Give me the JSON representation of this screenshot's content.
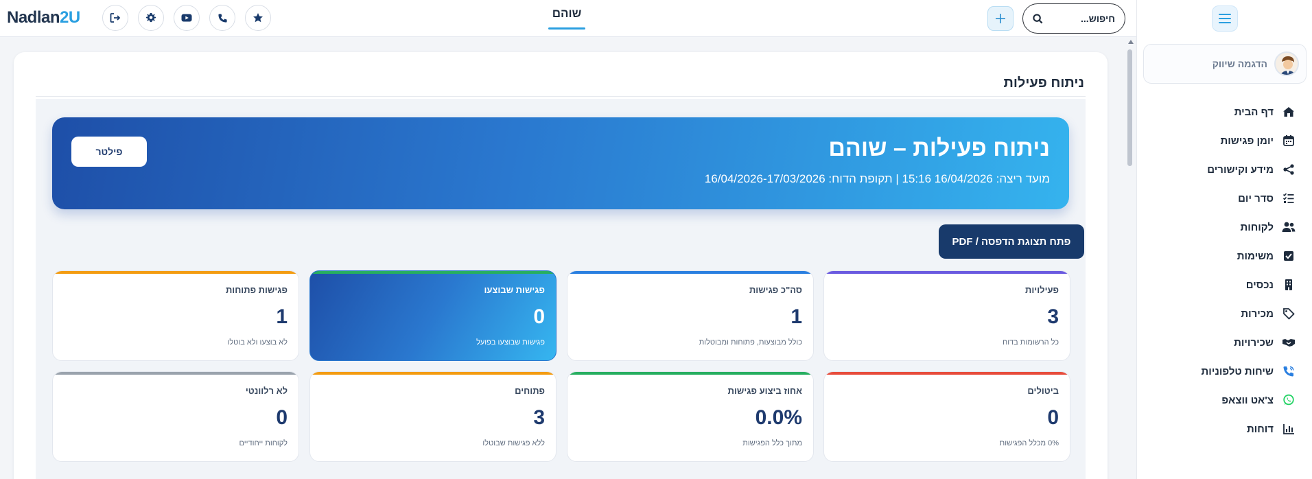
{
  "topbar": {
    "logo_main": "Nadlan",
    "logo_accent": "2U",
    "center_title": "שוהם",
    "search_placeholder": "חיפוש...",
    "buttons": [
      "logout",
      "settings",
      "youtube",
      "phone",
      "favorites"
    ]
  },
  "sidebar": {
    "user_name": "הדגמה שיווק",
    "items": [
      {
        "label": "דף הבית",
        "icon": "home-icon"
      },
      {
        "label": "יומן פגישות",
        "icon": "calendar-icon"
      },
      {
        "label": "מידע וקישורים",
        "icon": "share-icon"
      },
      {
        "label": "סדר יום",
        "icon": "checklist-icon"
      },
      {
        "label": "לקוחות",
        "icon": "users-icon"
      },
      {
        "label": "משימות",
        "icon": "checkbox-icon"
      },
      {
        "label": "נכסים",
        "icon": "building-icon"
      },
      {
        "label": "מכירות",
        "icon": "tag-icon"
      },
      {
        "label": "שכירויות",
        "icon": "handshake-icon"
      },
      {
        "label": "שיחות טלפוניות",
        "icon": "phone-call-icon"
      },
      {
        "label": "צ'אט ווצאפ",
        "icon": "whatsapp-icon"
      },
      {
        "label": "דוחות",
        "icon": "bar-chart-icon"
      }
    ],
    "colors": {
      "accent": "#2a9fe0",
      "whatsapp": "#25d366",
      "phone_call": "#2a7fe0"
    }
  },
  "main": {
    "page_title": "ניתוח פעילות",
    "hero": {
      "title": "ניתוח פעילות – שוהם",
      "subtitle": "מועד ריצה: 16/04/2026 15:16 | תקופת הדוח: 16/04/2026-17/03/2026",
      "filter_label": "פילטר"
    },
    "print_label": "פתח תצוגת הדפסה / PDF",
    "stats": [
      {
        "label": "פעילויות",
        "value": "3",
        "note": "כל הרשומות בדוח",
        "color": "#6a5ae0"
      },
      {
        "label": "סה\"כ פגישות",
        "value": "1",
        "note": "כולל מבוצעות, פתוחות ומבוטלות",
        "color": "#2a7fe0"
      },
      {
        "label": "פגישות שבוצעו",
        "value": "0",
        "note": "פגישות שבוצעו בפועל",
        "color": "#27ae60",
        "highlight": true
      },
      {
        "label": "פגישות פתוחות",
        "value": "1",
        "note": "לא בוצעו ולא בוטלו",
        "color": "#f39c12"
      },
      {
        "label": "ביטולים",
        "value": "0",
        "note": "0% מכלל הפגישות",
        "color": "#e74c3c"
      },
      {
        "label": "אחוז ביצוע פגישות",
        "value": "0.0%",
        "note": "מתוך כלל הפגישות",
        "color": "#27ae60"
      },
      {
        "label": "פתוחים",
        "value": "3",
        "note": "ללא פגישות שבוטלו",
        "color": "#f39c12"
      },
      {
        "label": "לא רלוונטי",
        "value": "0",
        "note": "לקוחות ייחודיים",
        "color": "#9aa3ad"
      }
    ]
  }
}
